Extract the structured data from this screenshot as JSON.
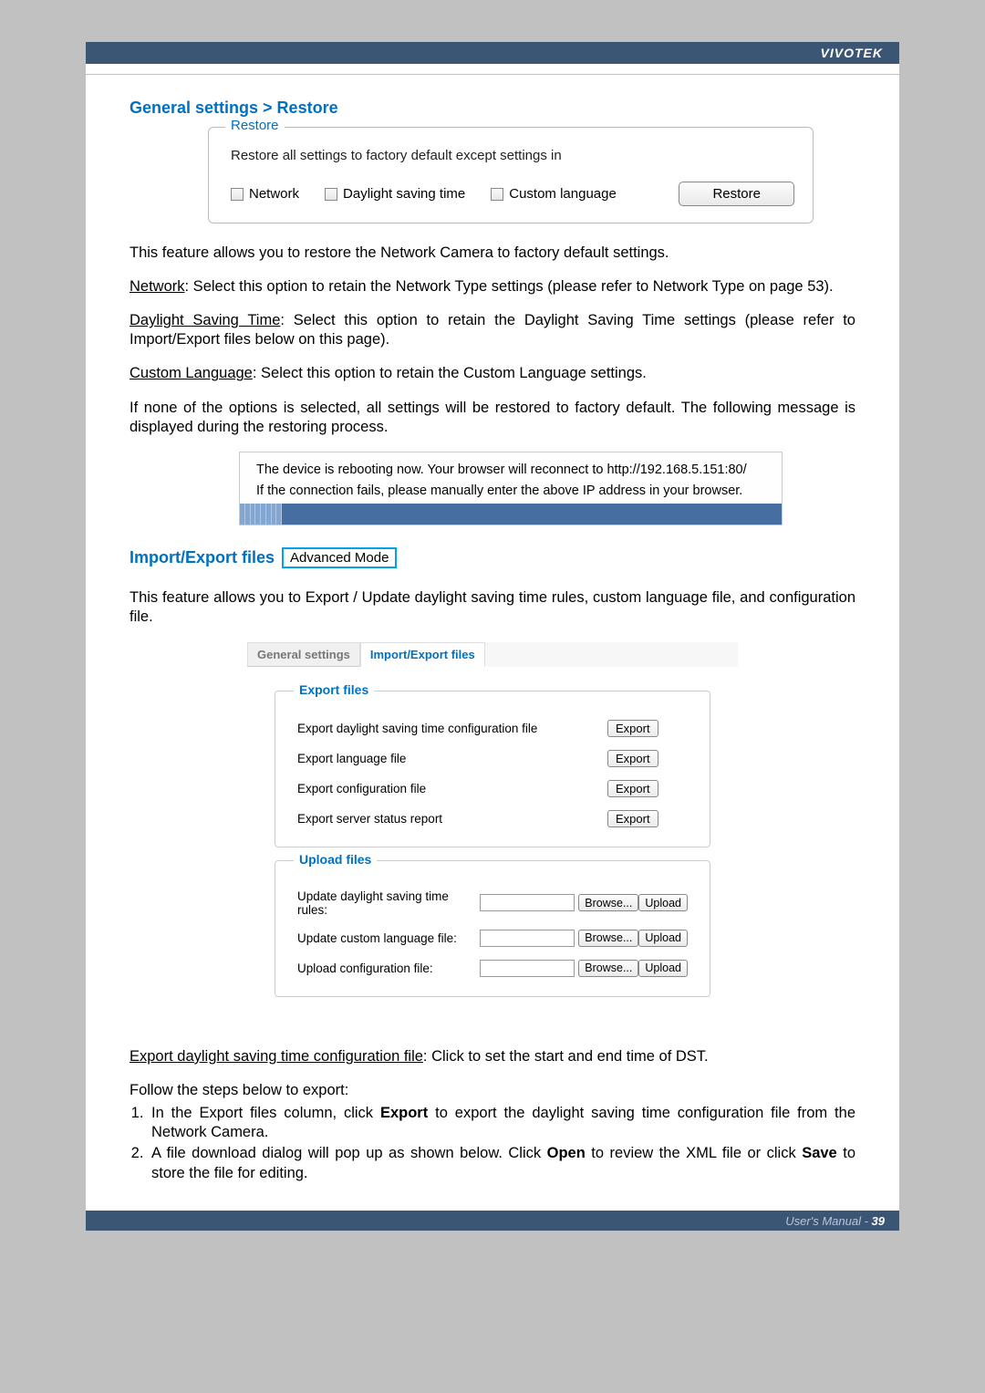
{
  "brand": "VIVOTEK",
  "section1": {
    "title": "General settings > Restore",
    "box_legend": "Restore",
    "box_desc": "Restore all settings to factory default except settings in",
    "cb1": "Network",
    "cb2": "Daylight saving time",
    "cb3": "Custom language",
    "button": "Restore"
  },
  "para": {
    "p1": "This feature allows you to restore the Network Camera to factory default settings.",
    "p2a": "Network",
    "p2b": ": Select this option to retain the Network Type settings (please refer to Network Type on page 53).",
    "p3a": "Daylight Saving Time",
    "p3b": ": Select this option to retain the Daylight Saving Time settings (please refer to Import/Export files below on this page).",
    "p4a": "Custom Language",
    "p4b": ": Select this option to retain the Custom Language settings.",
    "p5": "If none of the options is selected, all settings will be restored to factory default. The following message is displayed during the restoring process."
  },
  "reboot": {
    "l1": "The device is rebooting now. Your browser will reconnect to http://192.168.5.151:80/",
    "l2": "If the connection fails, please manually enter the above IP address in your browser."
  },
  "section2": {
    "title": "Import/Export files",
    "badge": "Advanced Mode",
    "intro": "This feature allows you to Export / Update daylight saving time rules, custom language file, and configuration file."
  },
  "panel": {
    "tab_general": "General settings",
    "tab_ie": "Import/Export files",
    "export_legend": "Export files",
    "e1": "Export daylight saving time configuration file",
    "e2": "Export language file",
    "e3": "Export configuration file",
    "e4": "Export server status report",
    "export_btn": "Export",
    "upload_legend": "Upload files",
    "u1": "Update daylight saving time rules:",
    "u2": "Update custom language file:",
    "u3": "Upload configuration file:",
    "browse_btn": "Browse...",
    "upload_btn": "Upload"
  },
  "lower": {
    "p1a": "Export daylight saving time configuration file",
    "p1b": ": Click to set the start and end time of DST.",
    "p2": "Follow the steps below to export:",
    "s1a": "In the Export files column, click ",
    "s1b": "Export",
    "s1c": " to export the daylight saving time configuration file from the Network Camera.",
    "s2a": "A file download dialog will pop up as shown below. Click ",
    "s2b": "Open",
    "s2c": " to review the XML file or click ",
    "s2d": "Save",
    "s2e": " to store the file for editing."
  },
  "footer": {
    "text": "User's Manual - ",
    "page": "39"
  }
}
